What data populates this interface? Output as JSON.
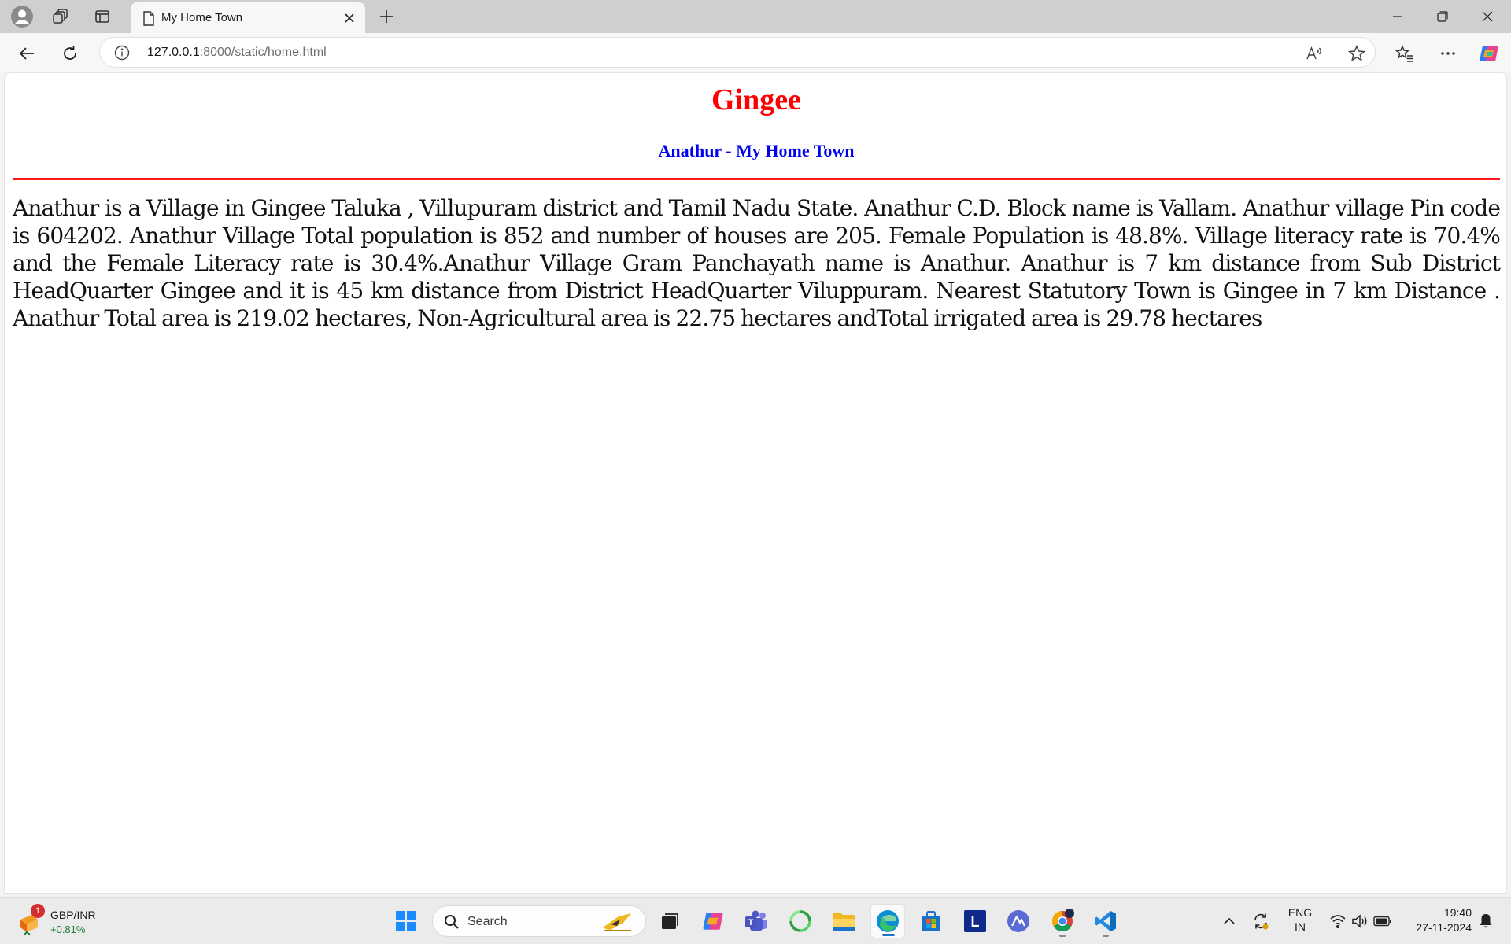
{
  "browser": {
    "tab_title": "My Home Town",
    "url_host": "127.0.0.1",
    "url_rest": ":8000/static/home.html"
  },
  "page": {
    "heading": "Gingee",
    "subheading": "Anathur - My Home Town",
    "paragraph": "Anathur is a Village in Gingee Taluka , Villupuram district and Tamil Nadu State. Anathur C.D. Block name is Vallam. Anathur village Pin code is 604202. Anathur Village Total population is 852 and number of houses are 205. Female Population is 48.8%. Village literacy rate is 70.4% and the Female Literacy rate is 30.4%.Anathur Village Gram Panchayath name is Anathur. Anathur is 7 km distance from Sub District HeadQuarter Gingee and it is 45 km distance from District HeadQuarter Viluppuram. Nearest Statutory Town is Gingee in 7 km Distance . Anathur Total area is 219.02 hectares, Non-Agricultural area is 22.75 hectares andTotal irrigated area is 29.78 hectares",
    "colors": {
      "heading": "#ff0000",
      "subheading": "#0000ee",
      "rule": "#ff1a1a"
    }
  },
  "taskbar": {
    "widget_name": "GBP/INR",
    "widget_value": "+0.81%",
    "widget_badge": "1",
    "search_placeholder": "Search",
    "language_line1": "ENG",
    "language_line2": "IN",
    "time": "19:40",
    "date": "27-11-2024",
    "apps": [
      "windows-start",
      "search",
      "task-view",
      "copilot",
      "teams",
      "cycle-app",
      "file-explorer",
      "edge",
      "microsoft-store",
      "l-app",
      "affinity-app",
      "chrome",
      "vscode"
    ]
  }
}
